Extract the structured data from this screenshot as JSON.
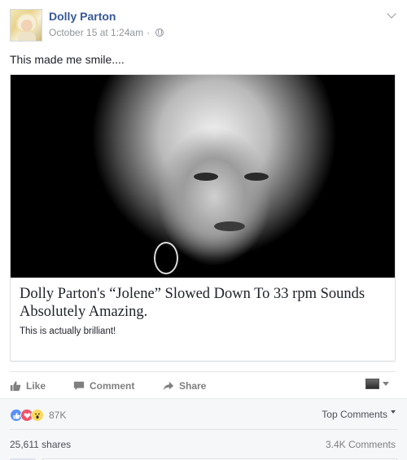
{
  "post": {
    "author": "Dolly Parton",
    "timestamp": "October 15 at 1:24am",
    "separator": "·",
    "privacy_icon": "globe-icon",
    "menu_icon": "chevron-down-icon",
    "text": "This made me smile...."
  },
  "link_card": {
    "title": "Dolly Parton's “Jolene” Slowed Down To 33 rpm Sounds Absolutely Amazing.",
    "description": "This is actually brilliant!"
  },
  "actions": {
    "like": "Like",
    "comment": "Comment",
    "share": "Share"
  },
  "reactions": {
    "types": [
      "like",
      "love",
      "wow"
    ],
    "count": "87K",
    "sort_label": "Top Comments",
    "shares": "25,611 shares",
    "comments": "3.4K Comments"
  },
  "colors": {
    "author_link": "#365899",
    "muted": "#90949c",
    "like_blue": "#5890ff",
    "love_red": "#f25268",
    "wow_yellow": "#fed859"
  }
}
